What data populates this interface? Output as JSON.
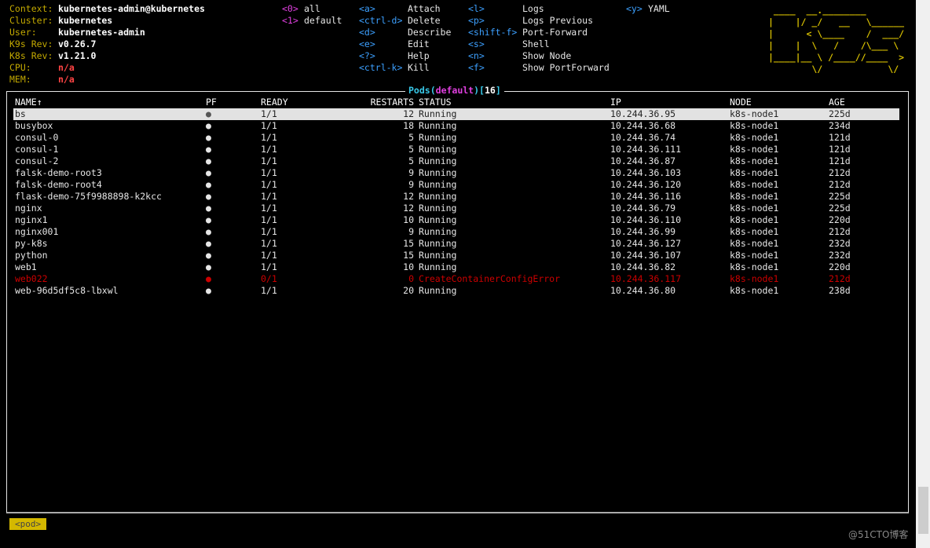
{
  "info": [
    {
      "label": "Context:",
      "value": "kubernetes-admin@kubernetes",
      "type": "val"
    },
    {
      "label": "Cluster:",
      "value": "kubernetes",
      "type": "val"
    },
    {
      "label": "User:",
      "value": "kubernetes-admin",
      "type": "val"
    },
    {
      "label": "K9s Rev:",
      "value": "v0.26.7",
      "type": "val"
    },
    {
      "label": "K8s Rev:",
      "value": "v1.21.0",
      "type": "val"
    },
    {
      "label": "CPU:",
      "value": "n/a",
      "type": "na"
    },
    {
      "label": "MEM:",
      "value": "n/a",
      "type": "na"
    }
  ],
  "namespaces": [
    {
      "key": "<0>",
      "label": "all"
    },
    {
      "key": "<1>",
      "label": "default"
    }
  ],
  "shortcuts_col1": [
    {
      "key": "<a>",
      "label": "Attach"
    },
    {
      "key": "<ctrl-d>",
      "label": "Delete"
    },
    {
      "key": "<d>",
      "label": "Describe"
    },
    {
      "key": "<e>",
      "label": "Edit"
    },
    {
      "key": "<?>",
      "label": "Help"
    },
    {
      "key": "<ctrl-k>",
      "label": "Kill"
    }
  ],
  "shortcuts_col2": [
    {
      "key": "<l>",
      "label": "Logs"
    },
    {
      "key": "<p>",
      "label": "Logs Previous"
    },
    {
      "key": "<shift-f>",
      "label": "Port-Forward"
    },
    {
      "key": "<s>",
      "label": "Shell"
    },
    {
      "key": "<n>",
      "label": "Show Node"
    },
    {
      "key": "<f>",
      "label": "Show PortForward"
    }
  ],
  "shortcuts_col3": [
    {
      "key": "<y>",
      "label": "YAML"
    }
  ],
  "logo": " ____  __.________       \n|    |/ _/   __   \\______\n|      < \\____    /  ___/\n|    |  \\   /    /\\___ \\ \n|____|__ \\ /____//____  >\n        \\/            \\/ ",
  "table": {
    "title": {
      "resource": "Pods",
      "namespace": "default",
      "count": "16"
    },
    "headers": {
      "name": "NAME↑",
      "pf": "PF",
      "ready": "READY",
      "restarts": "RESTARTS",
      "status": "STATUS",
      "ip": "IP",
      "node": "NODE",
      "age": "AGE"
    },
    "rows": [
      {
        "name": "bs",
        "pf": "●",
        "ready": "1/1",
        "restarts": "12",
        "status": "Running",
        "ip": "10.244.36.95",
        "node": "k8s-node1",
        "age": "225d",
        "state": "selected"
      },
      {
        "name": "busybox",
        "pf": "●",
        "ready": "1/1",
        "restarts": "18",
        "status": "Running",
        "ip": "10.244.36.68",
        "node": "k8s-node1",
        "age": "234d",
        "state": "ok"
      },
      {
        "name": "consul-0",
        "pf": "●",
        "ready": "1/1",
        "restarts": "5",
        "status": "Running",
        "ip": "10.244.36.74",
        "node": "k8s-node1",
        "age": "121d",
        "state": "ok"
      },
      {
        "name": "consul-1",
        "pf": "●",
        "ready": "1/1",
        "restarts": "5",
        "status": "Running",
        "ip": "10.244.36.111",
        "node": "k8s-node1",
        "age": "121d",
        "state": "ok"
      },
      {
        "name": "consul-2",
        "pf": "●",
        "ready": "1/1",
        "restarts": "5",
        "status": "Running",
        "ip": "10.244.36.87",
        "node": "k8s-node1",
        "age": "121d",
        "state": "ok"
      },
      {
        "name": "falsk-demo-root3",
        "pf": "●",
        "ready": "1/1",
        "restarts": "9",
        "status": "Running",
        "ip": "10.244.36.103",
        "node": "k8s-node1",
        "age": "212d",
        "state": "ok"
      },
      {
        "name": "falsk-demo-root4",
        "pf": "●",
        "ready": "1/1",
        "restarts": "9",
        "status": "Running",
        "ip": "10.244.36.120",
        "node": "k8s-node1",
        "age": "212d",
        "state": "ok"
      },
      {
        "name": "flask-demo-75f9988898-k2kcc",
        "pf": "●",
        "ready": "1/1",
        "restarts": "12",
        "status": "Running",
        "ip": "10.244.36.116",
        "node": "k8s-node1",
        "age": "225d",
        "state": "ok"
      },
      {
        "name": "nginx",
        "pf": "●",
        "ready": "1/1",
        "restarts": "12",
        "status": "Running",
        "ip": "10.244.36.79",
        "node": "k8s-node1",
        "age": "225d",
        "state": "ok"
      },
      {
        "name": "nginx1",
        "pf": "●",
        "ready": "1/1",
        "restarts": "10",
        "status": "Running",
        "ip": "10.244.36.110",
        "node": "k8s-node1",
        "age": "220d",
        "state": "ok"
      },
      {
        "name": "nginx001",
        "pf": "●",
        "ready": "1/1",
        "restarts": "9",
        "status": "Running",
        "ip": "10.244.36.99",
        "node": "k8s-node1",
        "age": "212d",
        "state": "ok"
      },
      {
        "name": "py-k8s",
        "pf": "●",
        "ready": "1/1",
        "restarts": "15",
        "status": "Running",
        "ip": "10.244.36.127",
        "node": "k8s-node1",
        "age": "232d",
        "state": "ok"
      },
      {
        "name": "python",
        "pf": "●",
        "ready": "1/1",
        "restarts": "15",
        "status": "Running",
        "ip": "10.244.36.107",
        "node": "k8s-node1",
        "age": "232d",
        "state": "ok"
      },
      {
        "name": "web1",
        "pf": "●",
        "ready": "1/1",
        "restarts": "10",
        "status": "Running",
        "ip": "10.244.36.82",
        "node": "k8s-node1",
        "age": "220d",
        "state": "ok"
      },
      {
        "name": "web022",
        "pf": "●",
        "ready": "0/1",
        "restarts": "0",
        "status": "CreateContainerConfigError",
        "ip": "10.244.36.117",
        "node": "k8s-node1",
        "age": "212d",
        "state": "error"
      },
      {
        "name": "web-96d5df5c8-lbxwl",
        "pf": "●",
        "ready": "1/1",
        "restarts": "20",
        "status": "Running",
        "ip": "10.244.36.80",
        "node": "k8s-node1",
        "age": "238d",
        "state": "ok"
      }
    ]
  },
  "breadcrumb": "<pod>",
  "watermark": "@51CTO博客",
  "colors": {
    "label": "#c2a800",
    "key": "#3ca0ff",
    "namespace_key": "#e040e0",
    "error": "#cc0000",
    "selected_bg": "#e2e2e2",
    "crumb_bg": "#d4b800"
  }
}
